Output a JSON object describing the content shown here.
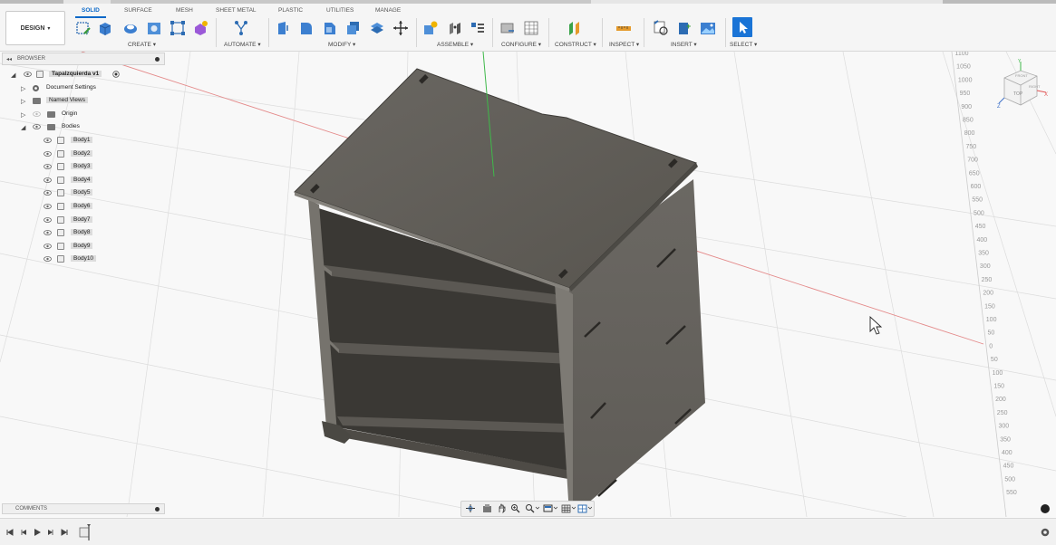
{
  "workspace": {
    "label": "DESIGN"
  },
  "tabs": [
    {
      "label": "SOLID",
      "active": true
    },
    {
      "label": "SURFACE",
      "active": false
    },
    {
      "label": "MESH",
      "active": false
    },
    {
      "label": "SHEET METAL",
      "active": false
    },
    {
      "label": "PLASTIC",
      "active": false
    },
    {
      "label": "UTILITIES",
      "active": false
    },
    {
      "label": "MANAGE",
      "active": false
    }
  ],
  "groups": [
    {
      "label": "CREATE ▾"
    },
    {
      "label": "AUTOMATE ▾"
    },
    {
      "label": "MODIFY ▾"
    },
    {
      "label": "ASSEMBLE ▾"
    },
    {
      "label": "CONFIGURE ▾"
    },
    {
      "label": "CONSTRUCT ▾"
    },
    {
      "label": "INSPECT ▾"
    },
    {
      "label": "INSERT ▾"
    },
    {
      "label": "SELECT ▾"
    }
  ],
  "browser": {
    "title": "BROWSER",
    "document": "Tapalzquierda v1",
    "items": [
      {
        "label": "Document Settings"
      },
      {
        "label": "Named Views"
      },
      {
        "label": "Origin"
      },
      {
        "label": "Bodies"
      }
    ],
    "bodies": [
      "Body1",
      "Body2",
      "Body3",
      "Body4",
      "Body5",
      "Body6",
      "Body7",
      "Body8",
      "Body9",
      "Body10"
    ]
  },
  "comments": {
    "title": "COMMENTS"
  },
  "viewcube": {
    "top": "TOP",
    "front": "FRONT",
    "right": "RIGHT",
    "x": "X",
    "z": "Z",
    "y": "Y"
  },
  "ruler": [
    "1100",
    "1050",
    "1000",
    "950",
    "900",
    "850",
    "800",
    "750",
    "700",
    "650",
    "600",
    "550",
    "500",
    "450",
    "400",
    "350",
    "300",
    "250",
    "200",
    "150",
    "100",
    "50",
    "0",
    "50",
    "100",
    "150",
    "200",
    "250",
    "300",
    "350",
    "400",
    "450",
    "500",
    "550"
  ],
  "colors": {
    "accent": "#0a68c8",
    "model": "#5f5c57",
    "axis_red": "#e05656",
    "axis_green": "#3fb94a"
  }
}
